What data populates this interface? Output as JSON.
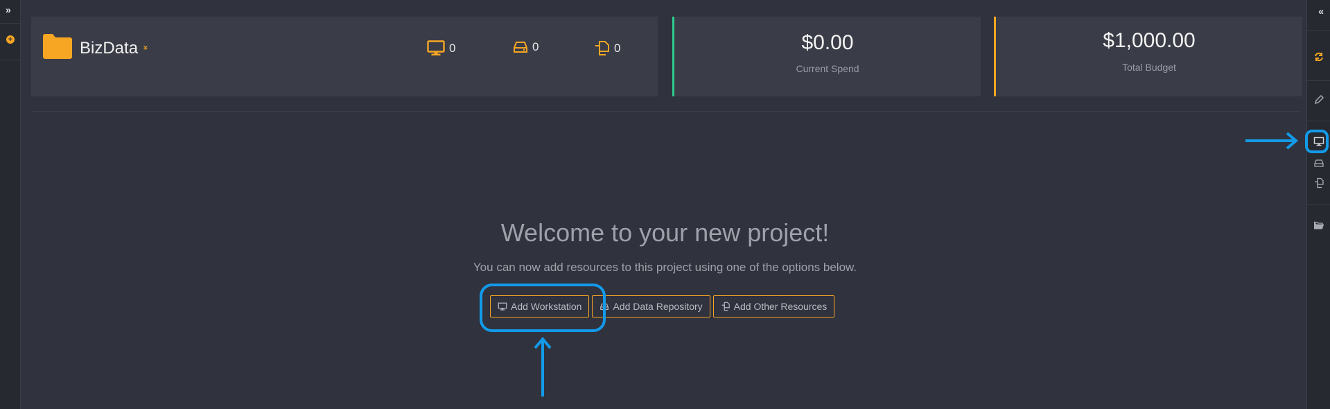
{
  "left_rail": {
    "expand_label": "»",
    "add_label": "+"
  },
  "right_rail": {
    "collapse_label": "«",
    "icons": [
      "refresh-icon",
      "pencil-icon",
      "monitor-icon",
      "drive-icon",
      "copy-icon",
      "folder-open-icon"
    ]
  },
  "project": {
    "name": "BizData",
    "chevron": "»",
    "workstations": "0",
    "data_repositories": "0",
    "other_resources": "0"
  },
  "spend": {
    "amount": "$0.00",
    "label": "Current Spend"
  },
  "budget": {
    "amount": "$1,000.00",
    "label": "Total Budget"
  },
  "welcome": {
    "title": "Welcome to your new project!",
    "subtitle": "You can now add resources to this project using one of the options below."
  },
  "actions": {
    "add_workstation": "Add Workstation",
    "add_data_repository": "Add Data Repository",
    "add_other_resources": "Add Other Resources"
  },
  "colors": {
    "accent": "#f6a623",
    "spend_border": "#2ecc8f",
    "annotation": "#139ae8"
  }
}
